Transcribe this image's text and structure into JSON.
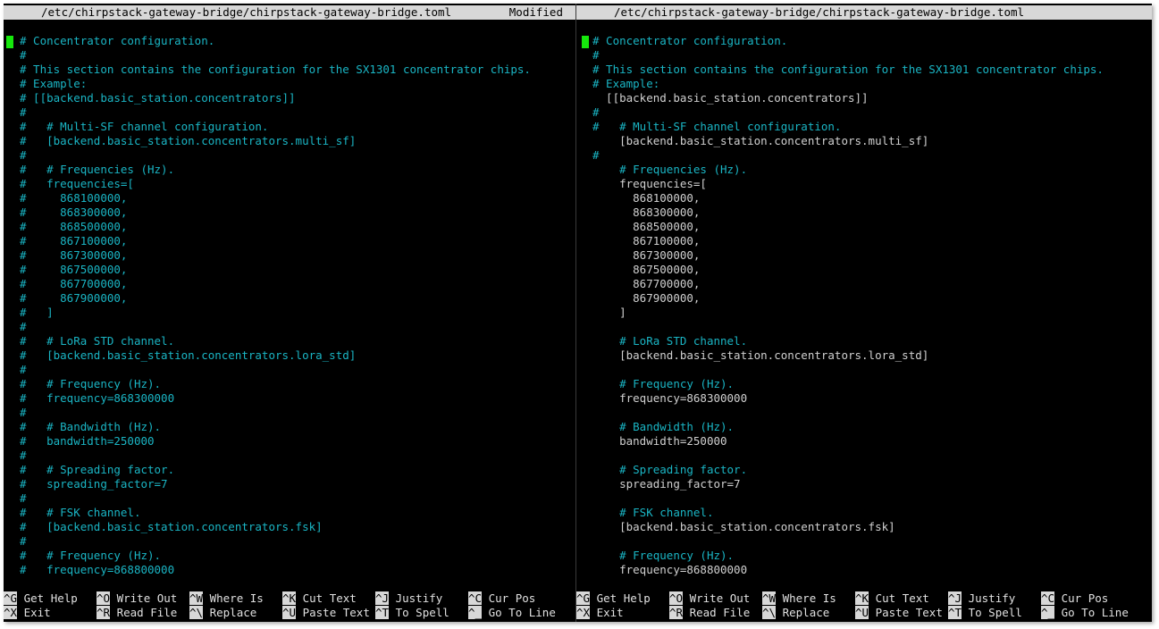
{
  "left_pane": {
    "title": "/etc/chirpstack-gateway-bridge/chirpstack-gateway-bridge.toml",
    "status": "Modified",
    "lines": [
      {
        "hash": "#",
        "text": " Concentrator configuration."
      },
      {
        "hash": "#",
        "text": ""
      },
      {
        "hash": "#",
        "text": " This section contains the configuration for the SX1301 concentrator chips."
      },
      {
        "hash": "#",
        "text": " Example:"
      },
      {
        "hash": "#",
        "text": " [[backend.basic_station.concentrators]]"
      },
      {
        "hash": "#",
        "text": ""
      },
      {
        "hash": "#",
        "text": "   # Multi-SF channel configuration."
      },
      {
        "hash": "#",
        "text": "   [backend.basic_station.concentrators.multi_sf]"
      },
      {
        "hash": "#",
        "text": ""
      },
      {
        "hash": "#",
        "text": "   # Frequencies (Hz)."
      },
      {
        "hash": "#",
        "text": "   frequencies=["
      },
      {
        "hash": "#",
        "text": "     868100000,"
      },
      {
        "hash": "#",
        "text": "     868300000,"
      },
      {
        "hash": "#",
        "text": "     868500000,"
      },
      {
        "hash": "#",
        "text": "     867100000,"
      },
      {
        "hash": "#",
        "text": "     867300000,"
      },
      {
        "hash": "#",
        "text": "     867500000,"
      },
      {
        "hash": "#",
        "text": "     867700000,"
      },
      {
        "hash": "#",
        "text": "     867900000,"
      },
      {
        "hash": "#",
        "text": "   ]"
      },
      {
        "hash": "#",
        "text": ""
      },
      {
        "hash": "#",
        "text": "   # LoRa STD channel."
      },
      {
        "hash": "#",
        "text": "   [backend.basic_station.concentrators.lora_std]"
      },
      {
        "hash": "#",
        "text": ""
      },
      {
        "hash": "#",
        "text": "   # Frequency (Hz)."
      },
      {
        "hash": "#",
        "text": "   frequency=868300000"
      },
      {
        "hash": "#",
        "text": ""
      },
      {
        "hash": "#",
        "text": "   # Bandwidth (Hz)."
      },
      {
        "hash": "#",
        "text": "   bandwidth=250000"
      },
      {
        "hash": "#",
        "text": ""
      },
      {
        "hash": "#",
        "text": "   # Spreading factor."
      },
      {
        "hash": "#",
        "text": "   spreading_factor=7"
      },
      {
        "hash": "#",
        "text": ""
      },
      {
        "hash": "#",
        "text": "   # FSK channel."
      },
      {
        "hash": "#",
        "text": "   [backend.basic_station.concentrators.fsk]"
      },
      {
        "hash": "#",
        "text": ""
      },
      {
        "hash": "#",
        "text": "   # Frequency (Hz)."
      },
      {
        "hash": "#",
        "text": "   frequency=868800000"
      }
    ]
  },
  "right_pane": {
    "title": "/etc/chirpstack-gateway-bridge/chirpstack-gateway-bridge.toml",
    "status": "",
    "lines": [
      {
        "hash": "#",
        "text": " Concentrator configuration."
      },
      {
        "hash": "#",
        "text": ""
      },
      {
        "hash": "#",
        "text": " This section contains the configuration for the SX1301 concentrator chips."
      },
      {
        "hash": "#",
        "text": " Example:"
      },
      {
        "hash": "",
        "text": " [[backend.basic_station.concentrators]]"
      },
      {
        "hash": "#",
        "text": ""
      },
      {
        "hash": "#",
        "text": "   # Multi-SF channel configuration."
      },
      {
        "hash": "",
        "text": "   [backend.basic_station.concentrators.multi_sf]"
      },
      {
        "hash": "#",
        "text": ""
      },
      {
        "hash": "",
        "text": "   # Frequencies (Hz)."
      },
      {
        "hash": "",
        "text": "   frequencies=["
      },
      {
        "hash": "",
        "text": "     868100000,"
      },
      {
        "hash": "",
        "text": "     868300000,"
      },
      {
        "hash": "",
        "text": "     868500000,"
      },
      {
        "hash": "",
        "text": "     867100000,"
      },
      {
        "hash": "",
        "text": "     867300000,"
      },
      {
        "hash": "",
        "text": "     867500000,"
      },
      {
        "hash": "",
        "text": "     867700000,"
      },
      {
        "hash": "",
        "text": "     867900000,"
      },
      {
        "hash": "",
        "text": "   ]"
      },
      {
        "hash": "",
        "text": ""
      },
      {
        "hash": "",
        "text": "   # LoRa STD channel."
      },
      {
        "hash": "",
        "text": "   [backend.basic_station.concentrators.lora_std]"
      },
      {
        "hash": "",
        "text": ""
      },
      {
        "hash": "",
        "text": "   # Frequency (Hz)."
      },
      {
        "hash": "",
        "text": "   frequency=868300000"
      },
      {
        "hash": "",
        "text": ""
      },
      {
        "hash": "",
        "text": "   # Bandwidth (Hz)."
      },
      {
        "hash": "",
        "text": "   bandwidth=250000"
      },
      {
        "hash": "",
        "text": ""
      },
      {
        "hash": "",
        "text": "   # Spreading factor."
      },
      {
        "hash": "",
        "text": "   spreading_factor=7"
      },
      {
        "hash": "",
        "text": ""
      },
      {
        "hash": "",
        "text": "   # FSK channel."
      },
      {
        "hash": "",
        "text": "   [backend.basic_station.concentrators.fsk]"
      },
      {
        "hash": "",
        "text": ""
      },
      {
        "hash": "",
        "text": "   # Frequency (Hz)."
      },
      {
        "hash": "",
        "text": "   frequency=868800000"
      }
    ]
  },
  "shortcuts": {
    "row1": [
      {
        "key": "^G",
        "label": "Get Help"
      },
      {
        "key": "^O",
        "label": "Write Out"
      },
      {
        "key": "^W",
        "label": "Where Is"
      },
      {
        "key": "^K",
        "label": "Cut Text"
      },
      {
        "key": "^J",
        "label": "Justify"
      },
      {
        "key": "^C",
        "label": "Cur Pos"
      }
    ],
    "row2": [
      {
        "key": "^X",
        "label": "Exit"
      },
      {
        "key": "^R",
        "label": "Read File"
      },
      {
        "key": "^\\",
        "label": "Replace"
      },
      {
        "key": "^U",
        "label": "Paste Text"
      },
      {
        "key": "^T",
        "label": "To Spell"
      },
      {
        "key": "^_",
        "label": "Go To Line"
      }
    ]
  },
  "colors": {
    "background": "#000000",
    "comment": "#1ab5c4",
    "text": "#d0d0d0",
    "titlebar": "#d8d8d8",
    "cursor": "#16e80c"
  }
}
